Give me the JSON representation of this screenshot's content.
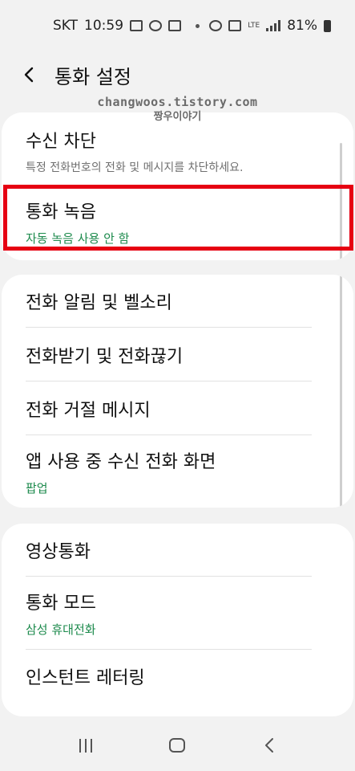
{
  "status_bar": {
    "carrier": "SKT",
    "time": "10:59",
    "network": "LTE",
    "battery_percent": "81%"
  },
  "header": {
    "title": "통화 설정"
  },
  "watermark": {
    "line1": "changwoos.tistory.com",
    "line2": "짱우이야기"
  },
  "cards": [
    {
      "items": [
        {
          "title": "수신 차단",
          "subtitle": "특정 전화번호의 전화 및 메시지를 차단하세요."
        },
        {
          "title": "통화 녹음",
          "subtitle": "자동 녹음 사용 안 함"
        }
      ]
    },
    {
      "items": [
        {
          "title": "전화 알림 및 벨소리"
        },
        {
          "title": "전화받기 및 전화끊기"
        },
        {
          "title": "전화 거절 메시지"
        },
        {
          "title": "앱 사용 중 수신 전화 화면",
          "subtitle": "팝업"
        }
      ]
    },
    {
      "items": [
        {
          "title": "영상통화"
        },
        {
          "title": "통화 모드",
          "subtitle": "삼성 휴대전화"
        },
        {
          "title": "인스턴트 레터링"
        }
      ]
    }
  ],
  "colors": {
    "accent_green": "#1c8a4c",
    "highlight_red": "#e60012",
    "background": "#f2f2f2"
  }
}
